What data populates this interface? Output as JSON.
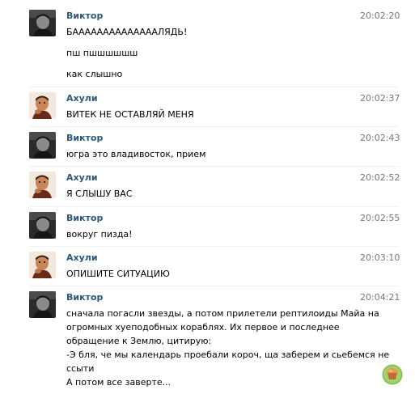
{
  "messages": [
    {
      "author": "Виктор",
      "avatar": "viktor-avatar",
      "time": "20:02:20",
      "lines": [
        "БААААААААААААААЛЯДЬ!",
        "пш пшшшшшш",
        "как слышно"
      ]
    },
    {
      "author": "Ахули",
      "avatar": "akhuli-avatar",
      "time": "20:02:37",
      "lines": [
        "ВИТЕК НЕ ОСТАВЛЯЙ МЕНЯ"
      ]
    },
    {
      "author": "Виктор",
      "avatar": "viktor-avatar",
      "time": "20:02:43",
      "lines": [
        "югра это владивосток, прием"
      ]
    },
    {
      "author": "Ахули",
      "avatar": "akhuli-avatar",
      "time": "20:02:52",
      "lines": [
        "Я СЛЫШУ ВАС"
      ]
    },
    {
      "author": "Виктор",
      "avatar": "viktor-avatar",
      "time": "20:02:55",
      "lines": [
        "вокруг пизда!"
      ]
    },
    {
      "author": "Ахули",
      "avatar": "akhuli-avatar",
      "time": "20:03:10",
      "lines": [
        "ОПИШИТЕ СИТУАЦИЮ"
      ]
    },
    {
      "author": "Виктор",
      "avatar": "viktor-avatar",
      "time": "20:04:21",
      "lines": [
        "сначала погасли звезды, а потом прилетели рептилоиды Майа на",
        "огромных хуеподобных кораблях. Их первое и последнее",
        "обращение к Землю, цитирую:",
        "-Э бля, че мы календарь проебали короч, ща заберем и сьебемся не",
        "ссыти",
        "А потом все заверте..."
      ]
    }
  ],
  "emoji_button": {
    "icon": "muffin-icon"
  },
  "colors": {
    "author": "#2b587a",
    "time": "#777777",
    "text": "#000000",
    "background": "#ffffff"
  }
}
